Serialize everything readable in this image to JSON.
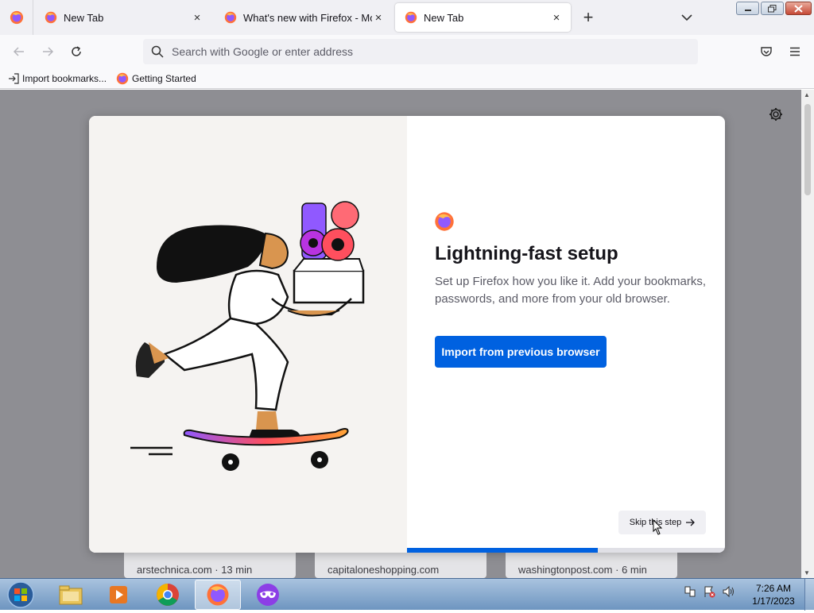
{
  "tabs": [
    {
      "label": "New Tab",
      "close": "×"
    },
    {
      "label": "What's new with Firefox - More",
      "close": "×"
    },
    {
      "label": "New Tab",
      "close": "×"
    }
  ],
  "tabstrip": {
    "new_tab": "+"
  },
  "urlbar": {
    "placeholder": "Search with Google or enter address"
  },
  "bookmarks": [
    {
      "label": "Import bookmarks...",
      "icon": "import-icon"
    },
    {
      "label": "Getting Started",
      "icon": "firefox-icon"
    }
  ],
  "onboarding": {
    "headline": "Lightning-fast setup",
    "subtext": "Set up Firefox how you like it. Add your bookmarks, passwords, and more from your old browser.",
    "primary_button": "Import from previous browser",
    "skip_button": "Skip this step",
    "progress": 0.6
  },
  "top_sites": [
    {
      "label": "arstechnica.com · 13 min"
    },
    {
      "label": "capitaloneshopping.com"
    },
    {
      "label": "washingtonpost.com · 6 min"
    }
  ],
  "taskbar": {
    "items": [
      "explorer",
      "media-player",
      "chrome",
      "firefox",
      "private-browser"
    ],
    "time": "7:26 AM",
    "date": "1/17/2023"
  },
  "colors": {
    "accent": "#0061e0",
    "content_dim": "#8e8e93"
  }
}
